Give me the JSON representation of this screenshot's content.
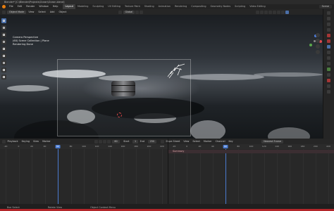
{
  "window": {
    "title": "Blender* [C:\\Blender\\Projects\\Ocean\\Ocean.blend]"
  },
  "menu": [
    "File",
    "Edit",
    "Render",
    "Window",
    "Help"
  ],
  "workspaces": [
    "Layout",
    "Modeling",
    "Sculpting",
    "UV Editing",
    "Texture Paint",
    "Shading",
    "Animation",
    "Rendering",
    "Compositing",
    "Geometry Nodes",
    "Scripting",
    "Video Editing"
  ],
  "active_workspace": "Layout",
  "scene": "Scene",
  "viewport_header": {
    "mode": "Object Mode",
    "menus": [
      "View",
      "Select",
      "Add",
      "Object"
    ],
    "orientation": "Global"
  },
  "viewport_info": {
    "line1": "Camera Perspective",
    "line2": "(60) Scene Collection | Plane",
    "line3": "Rendering Done"
  },
  "timeline_left": {
    "editor": "Playback",
    "menus": [
      "Keying",
      "View",
      "Marker"
    ],
    "frame_current": "60",
    "start_label": "Start",
    "start": "1",
    "end_label": "End",
    "end": "250",
    "ticks": [
      "-20",
      "0",
      "20",
      "40",
      "60",
      "80",
      "100",
      "120",
      "140",
      "160",
      "180",
      "200",
      "220"
    ]
  },
  "timeline_right": {
    "editor": "Dope Sheet",
    "menus": [
      "View",
      "Select",
      "Marker",
      "Channel",
      "Key"
    ],
    "interpolation": "Nearest Frame",
    "summary": "Summary",
    "ticks": [
      "-20",
      "0",
      "20",
      "40",
      "60",
      "80",
      "100",
      "120",
      "140",
      "160",
      "180",
      "200",
      "220"
    ]
  },
  "status_bar": {
    "item1": "Box Select",
    "item2": "Rotate View",
    "item3": "Object Context Menu"
  },
  "colors": {
    "accent": "#4a7bd0",
    "active_tool": "#4b6fa8",
    "logo": "#e87d0d",
    "error_bar": "#b3262a"
  }
}
